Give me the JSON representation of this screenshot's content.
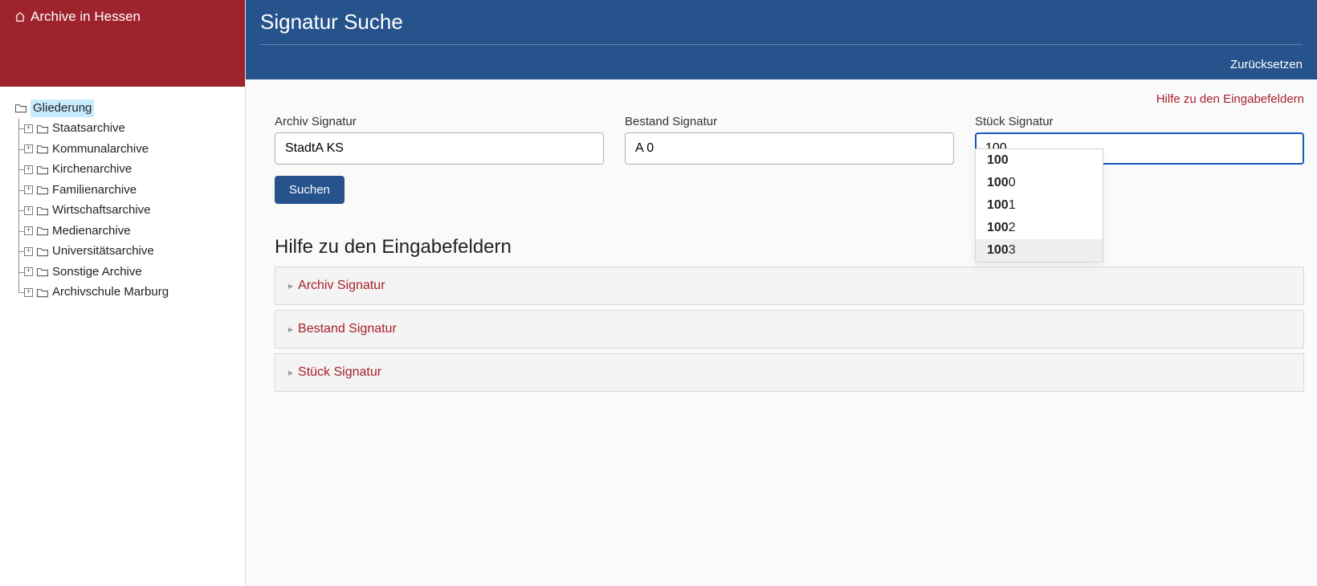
{
  "sidebar": {
    "title": "Archive in Hessen",
    "root": {
      "label": "Gliederung"
    },
    "items": [
      {
        "label": "Staatsarchive"
      },
      {
        "label": "Kommunalarchive"
      },
      {
        "label": "Kirchenarchive"
      },
      {
        "label": "Familienarchive"
      },
      {
        "label": "Wirtschaftsarchive"
      },
      {
        "label": "Medienarchive"
      },
      {
        "label": "Universitätsarchive"
      },
      {
        "label": "Sonstige Archive"
      },
      {
        "label": "Archivschule Marburg"
      }
    ]
  },
  "header": {
    "title": "Signatur Suche",
    "reset_label": "Zurücksetzen"
  },
  "help_link": "Hilfe zu den Eingabefeldern",
  "form": {
    "archive": {
      "label": "Archiv Signatur",
      "value": "StadtA KS"
    },
    "bestand": {
      "label": "Bestand Signatur",
      "value": "A 0"
    },
    "stueck": {
      "label": "Stück Signatur",
      "value": "100"
    },
    "submit_label": "Suchen",
    "suggestions": [
      {
        "prefix": "100",
        "rest": ""
      },
      {
        "prefix": "100",
        "rest": "0"
      },
      {
        "prefix": "100",
        "rest": "1"
      },
      {
        "prefix": "100",
        "rest": "2"
      },
      {
        "prefix": "100",
        "rest": "3"
      }
    ]
  },
  "accordion": {
    "title": "Hilfe zu den Eingabefeldern",
    "items": [
      {
        "label": "Archiv Signatur"
      },
      {
        "label": "Bestand Signatur"
      },
      {
        "label": "Stück Signatur"
      }
    ]
  }
}
